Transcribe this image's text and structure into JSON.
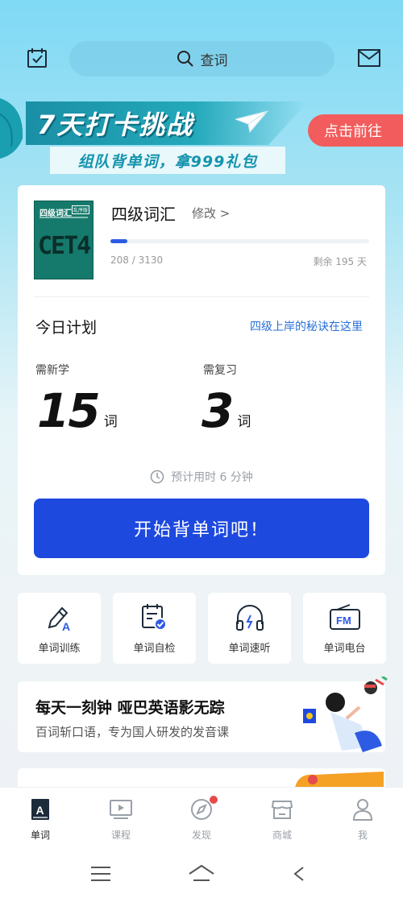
{
  "header": {
    "search_placeholder": "查词",
    "icons": [
      "calendar-check-icon",
      "search-icon",
      "mail-icon"
    ]
  },
  "banner": {
    "title": "7天打卡挑战",
    "subtitle": "组队背单词，拿999礼包",
    "cta_label": "点击前往"
  },
  "book": {
    "cover_title": "四级词汇",
    "cover_badge": "乱序版",
    "cover_big": "CET4",
    "name": "四级词汇",
    "modify_label": "修改 >",
    "progress_text": "208 / 3130",
    "progress_fraction": 0.0665,
    "remaining": "剩余 195 天"
  },
  "plan": {
    "title": "今日计划",
    "secret_link": "四级上岸的秘诀在这里",
    "new_label": "需新学",
    "new_count": "15",
    "review_label": "需复习",
    "review_count": "3",
    "unit": "词",
    "estimate": "预计用时 6 分钟",
    "start_button": "开始背单词吧！"
  },
  "tools": [
    {
      "label": "单词训练",
      "icon": "pencil-a-icon"
    },
    {
      "label": "单词自检",
      "icon": "calendar-check-icon"
    },
    {
      "label": "单词速听",
      "icon": "headphones-icon"
    },
    {
      "label": "单词电台",
      "icon": "fm-radio-icon"
    }
  ],
  "promo": {
    "title": "每天一刻钟 哑巴英语影无踪",
    "subtitle": "百词斩口语，专为国人研发的发音课"
  },
  "tabs": [
    {
      "label": "单词",
      "icon": "word-book-icon",
      "active": true
    },
    {
      "label": "课程",
      "icon": "video-course-icon",
      "active": false
    },
    {
      "label": "发现",
      "icon": "compass-icon",
      "active": false
    },
    {
      "label": "商城",
      "icon": "store-icon",
      "active": false
    },
    {
      "label": "我",
      "icon": "profile-icon",
      "active": false
    }
  ],
  "colors": {
    "primary": "#1e49df",
    "accent_red": "#f25c5c",
    "link_blue": "#2a6fd6"
  }
}
